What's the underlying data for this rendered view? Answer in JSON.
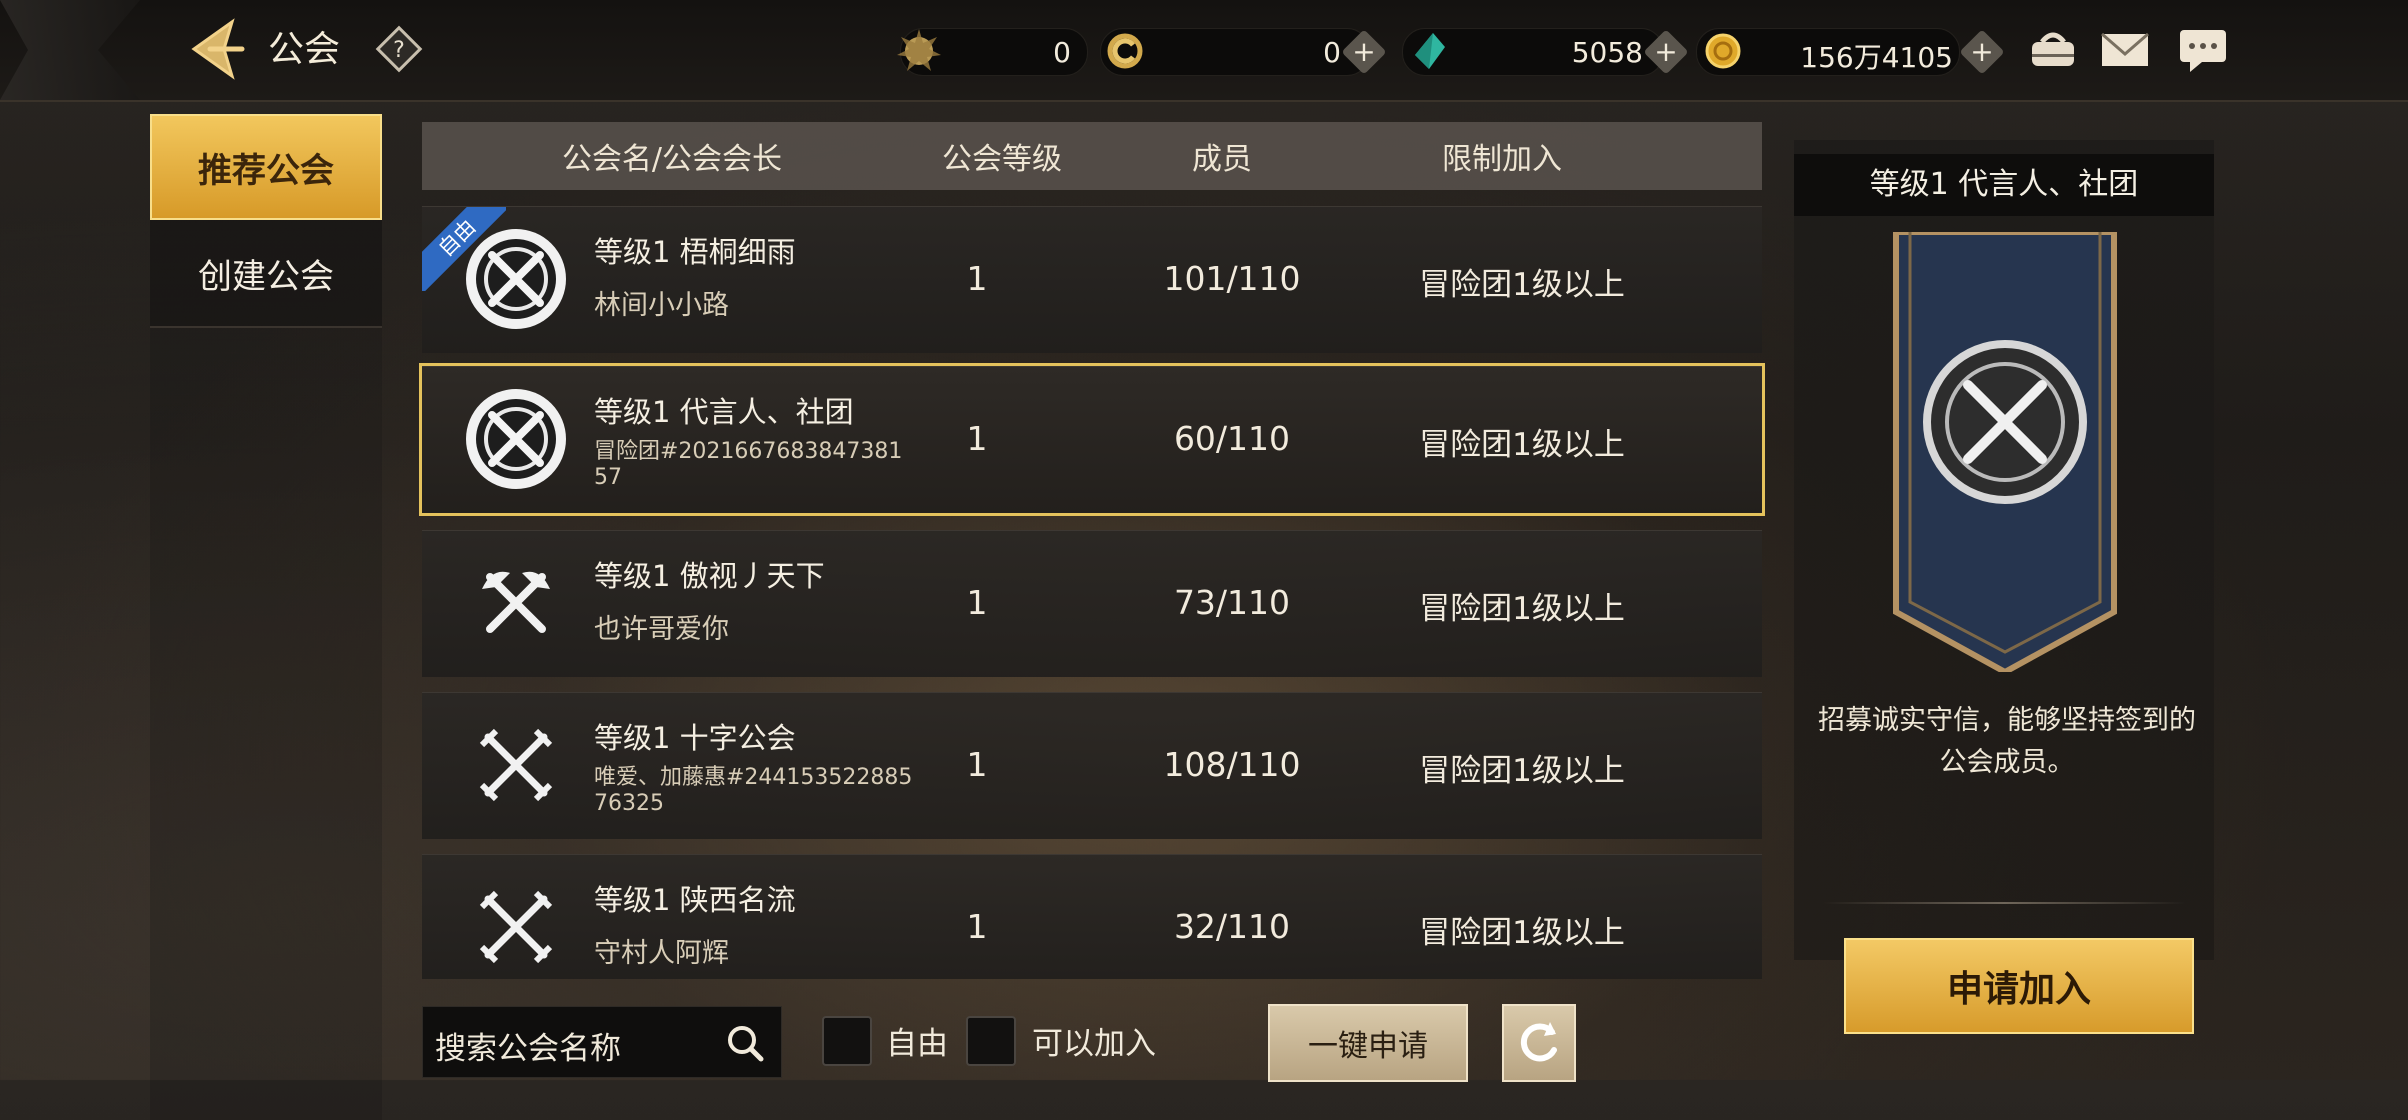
{
  "header": {
    "title": "公会",
    "resources": [
      {
        "name": "medal",
        "value": "0"
      },
      {
        "name": "coin-c",
        "value": "0"
      },
      {
        "name": "gem",
        "value": "5058"
      },
      {
        "name": "gold",
        "value": "156万4105"
      }
    ],
    "icons": [
      "back-icon",
      "help-icon",
      "bag-icon",
      "mail-icon",
      "chat-icon"
    ]
  },
  "sidebar": {
    "items": [
      {
        "label": "推荐公会",
        "active": true
      },
      {
        "label": "创建公会",
        "active": false
      }
    ]
  },
  "table": {
    "headers": [
      "公会名/公会会长",
      "公会等级",
      "成员",
      "限制加入"
    ],
    "rows": [
      {
        "name": "等级1 梧桐细雨",
        "leader": "林间小小路",
        "level": "1",
        "members": "101/110",
        "limit": "冒险团1级以上",
        "tag": "自由",
        "emblem": "crossed-swords-round"
      },
      {
        "name": "等级1 代言人、社团",
        "leader": "冒险团#202166768384738157",
        "level": "1",
        "members": "60/110",
        "limit": "冒险团1级以上",
        "emblem": "crossed-swords-round",
        "selected": true
      },
      {
        "name": "等级1 傲视丿天下",
        "leader": "也许哥爱你",
        "level": "1",
        "members": "73/110",
        "limit": "冒险团1级以上",
        "emblem": "crossed-axes"
      },
      {
        "name": "等级1 十字公会",
        "leader": "唯爱、加藤惠#24415352288576325",
        "level": "1",
        "members": "108/110",
        "limit": "冒险团1级以上",
        "emblem": "crossed-swords"
      },
      {
        "name": "等级1 陕西名流",
        "leader": "守村人阿辉",
        "level": "1",
        "members": "32/110",
        "limit": "冒险团1级以上",
        "emblem": "crossed-swords"
      }
    ]
  },
  "footer": {
    "search_placeholder": "搜索公会名称",
    "filter_free": "自由",
    "filter_joinable": "可以加入",
    "apply_all": "一键申请"
  },
  "detail": {
    "title": "等级1 代言人、社团",
    "description": "招募诚实守信，能够坚持签到的公会成员。",
    "join": "申请加入"
  }
}
